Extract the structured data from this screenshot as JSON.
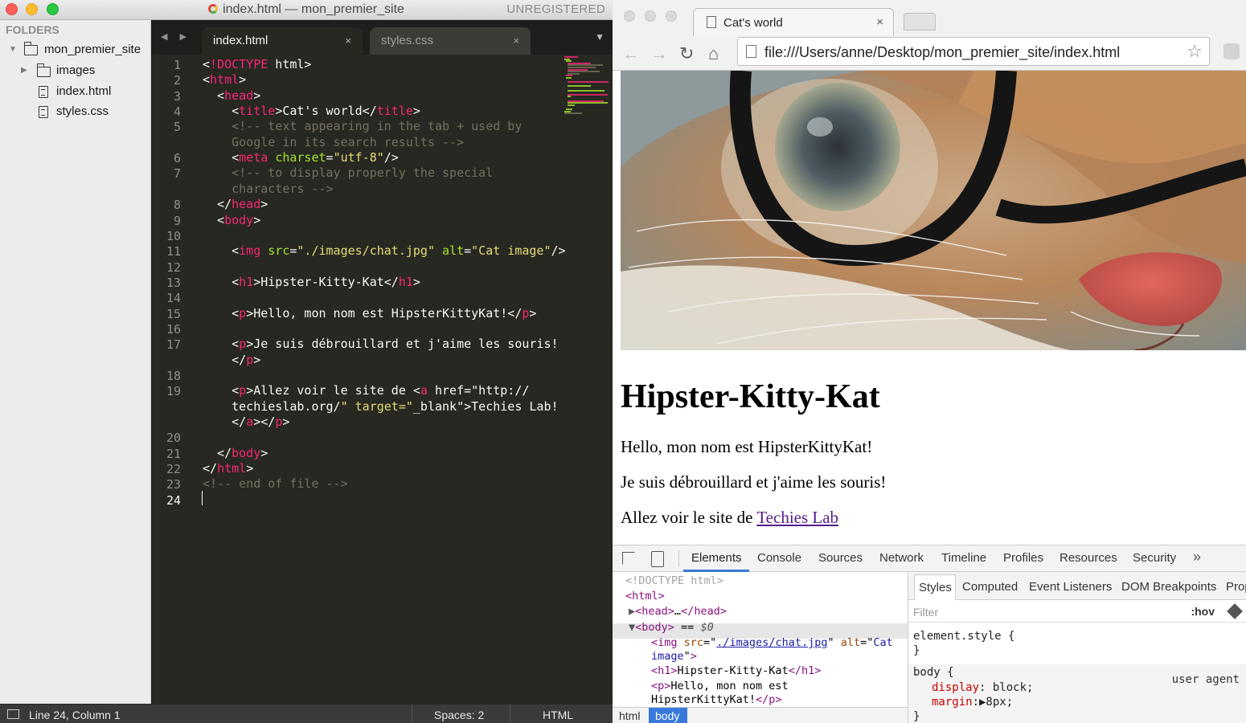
{
  "editor": {
    "title": "index.html — mon_premier_site",
    "unregistered": "UNREGISTERED",
    "sidebar": {
      "header": "FOLDERS",
      "project": "mon_premier_site",
      "items": [
        {
          "label": "images",
          "kind": "folder"
        },
        {
          "label": "index.html",
          "kind": "file"
        },
        {
          "label": "styles.css",
          "kind": "file"
        }
      ]
    },
    "tabs": [
      {
        "label": "index.html",
        "active": true
      },
      {
        "label": "styles.css",
        "active": false
      }
    ],
    "close_glyph": "×",
    "code_lines": [
      {
        "n": "1",
        "html": "<span class=\"tg\">&lt;!</span><span class=\"tg\">DOCTYPE</span> html<span class=\"tg\">&gt;</span>",
        "raw": "<!DOCTYPE html>"
      },
      {
        "n": "2",
        "raw": "<html>"
      },
      {
        "n": "3",
        "raw": "  <head>"
      },
      {
        "n": "4",
        "raw": "    <title>Cat's world</title>"
      },
      {
        "n": "5",
        "raw": "    <!-- text appearing in the tab + used by"
      },
      {
        "n": "",
        "raw": "    Google in its search results -->"
      },
      {
        "n": "6",
        "raw": "    <meta charset=\"utf-8\"/>"
      },
      {
        "n": "7",
        "raw": "    <!-- to display properly the special"
      },
      {
        "n": "",
        "raw": "    characters -->"
      },
      {
        "n": "8",
        "raw": "  </head>"
      },
      {
        "n": "9",
        "raw": "  <body>"
      },
      {
        "n": "10",
        "raw": ""
      },
      {
        "n": "11",
        "raw": "    <img src=\"./images/chat.jpg\" alt=\"Cat image\"/>"
      },
      {
        "n": "12",
        "raw": ""
      },
      {
        "n": "13",
        "raw": "    <h1>Hipster-Kitty-Kat</h1>"
      },
      {
        "n": "14",
        "raw": ""
      },
      {
        "n": "15",
        "raw": "    <p>Hello, mon nom est HipsterKittyKat!</p>"
      },
      {
        "n": "16",
        "raw": ""
      },
      {
        "n": "17",
        "raw": "    <p>Je suis débrouillard et j'aime les souris!"
      },
      {
        "n": "",
        "raw": "    </p>"
      },
      {
        "n": "18",
        "raw": ""
      },
      {
        "n": "19",
        "raw": "    <p>Allez voir le site de <a href=\"http://"
      },
      {
        "n": "",
        "raw": "    techieslab.org/\" target=\"_blank\">Techies Lab!"
      },
      {
        "n": "",
        "raw": "    </a></p>"
      },
      {
        "n": "20",
        "raw": ""
      },
      {
        "n": "21",
        "raw": "  </body>"
      },
      {
        "n": "22",
        "raw": "</html>"
      },
      {
        "n": "23",
        "raw": "<!-- end of file -->"
      },
      {
        "n": "24",
        "raw": ""
      }
    ],
    "status": {
      "position": "Line 24, Column 1",
      "spaces": "Spaces: 2",
      "syntax": "HTML"
    }
  },
  "browser": {
    "tab_title": "Cat's world",
    "tab_close": "×",
    "url": "file:///Users/anne/Desktop/mon_premier_site/index.html",
    "nav": {
      "back": "←",
      "forward": "→",
      "reload": "↻",
      "home": "⌂",
      "star": "☆"
    },
    "page": {
      "image_alt": "Cat image",
      "h1": "Hipster-Kitty-Kat",
      "p1": "Hello, mon nom est HipsterKittyKat!",
      "p2": "Je suis débrouillard et j'aime les souris!",
      "p3_prefix": "Allez voir le site de ",
      "link": "Techies Lab"
    },
    "devtools": {
      "tabs": [
        "Elements",
        "Console",
        "Sources",
        "Network",
        "Timeline",
        "Profiles",
        "Resources",
        "Security"
      ],
      "more": "»",
      "breadcrumbs": [
        "html",
        "body"
      ],
      "styles_tabs": [
        "Styles",
        "Computed",
        "Event Listeners",
        "DOM Breakpoints",
        "Prop"
      ],
      "filter_placeholder": "Filter",
      "hov": ":hov",
      "element_style": "element.style {",
      "close_brace": "}",
      "body_selector": "body {",
      "user_agent": "user agent",
      "decl1_prop": "display",
      "decl1_val": ": block;",
      "decl2_prop": "margin",
      "decl2_val": ":▶8px;"
    }
  }
}
